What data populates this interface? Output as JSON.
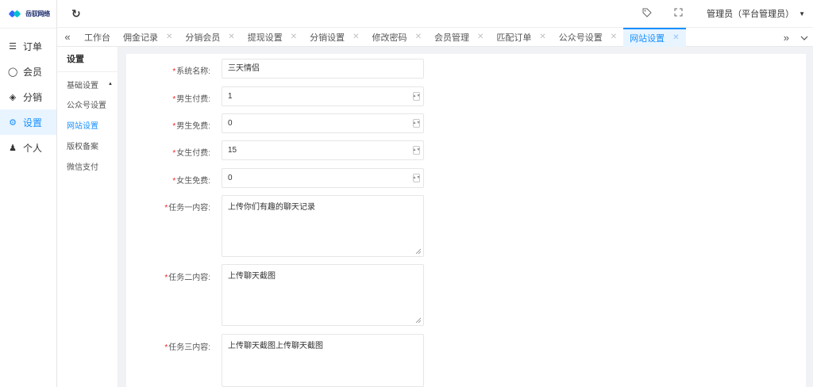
{
  "brand": {
    "logo_text": "岳驭网络"
  },
  "sidebar": {
    "items": [
      {
        "label": "订单",
        "icon": "list-icon"
      },
      {
        "label": "会员",
        "icon": "user-icon"
      },
      {
        "label": "分销",
        "icon": "layers-icon"
      },
      {
        "label": "设置",
        "icon": "gear-icon"
      },
      {
        "label": "个人",
        "icon": "person-icon"
      }
    ],
    "active": "设置"
  },
  "header": {
    "user_label": "管理员（平台管理员）"
  },
  "tabs": [
    {
      "label": "工作台"
    },
    {
      "label": "佣金记录"
    },
    {
      "label": "分销会员"
    },
    {
      "label": "提现设置"
    },
    {
      "label": "分销设置"
    },
    {
      "label": "修改密码"
    },
    {
      "label": "会员管理"
    },
    {
      "label": "匹配订单"
    },
    {
      "label": "公众号设置"
    },
    {
      "label": "网站设置"
    }
  ],
  "submenu": {
    "title": "设置",
    "group_label": "基础设置",
    "items": [
      "公众号设置",
      "网站设置",
      "版权备案",
      "微信支付"
    ],
    "active": "网站设置"
  },
  "form": {
    "site_name": {
      "label": "系统名称:",
      "value": "三天情侣"
    },
    "male_paid": {
      "label": "男生付费:",
      "value": "1"
    },
    "male_free": {
      "label": "男生免费:",
      "value": "0"
    },
    "female_paid": {
      "label": "女生付费:",
      "value": "15"
    },
    "female_free": {
      "label": "女生免费:",
      "value": "0"
    },
    "task1": {
      "label": "任务一内容:",
      "value": "上传你们有趣的聊天记录"
    },
    "task2": {
      "label": "任务二内容:",
      "value": "上传聊天截图"
    },
    "task3": {
      "label": "任务三内容:",
      "value": "上传聊天截图上传聊天截图"
    },
    "required_mark": "*"
  },
  "colors": {
    "accent": "#1890ff",
    "required": "#f5222d"
  }
}
